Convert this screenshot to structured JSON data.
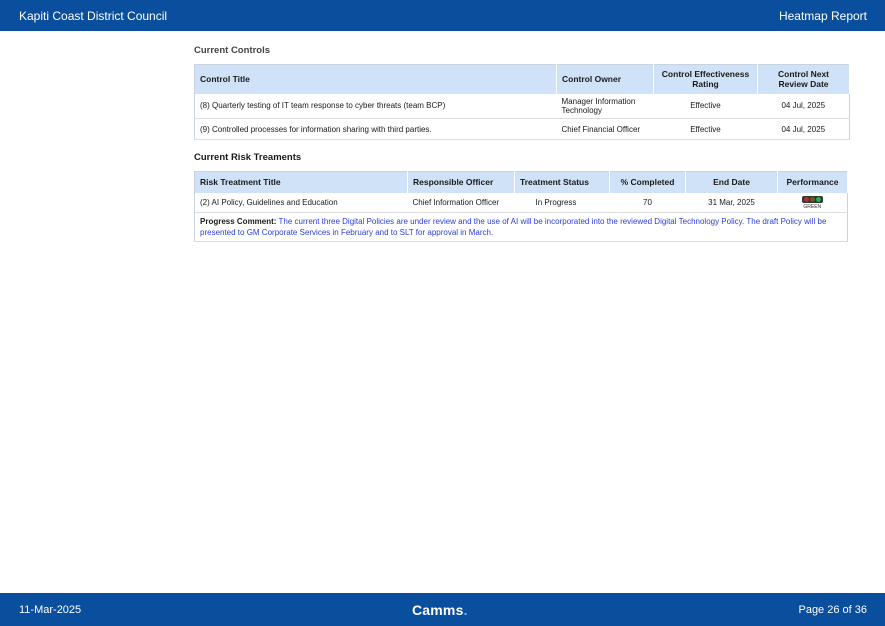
{
  "header": {
    "org": "Kapiti Coast District Council",
    "report": "Heatmap Report"
  },
  "controls": {
    "section_title": "Current Controls",
    "columns": [
      "Control Title",
      "Control Owner",
      "Control Effectiveness Rating",
      "Control Next Review Date"
    ],
    "rows": [
      {
        "title": "(8) Quarterly testing of IT team response to cyber threats (team BCP)",
        "owner": "Manager Information Technology",
        "rating": "Effective",
        "review_date": "04 Jul, 2025"
      },
      {
        "title": "(9) Controlled processes for information sharing with third parties.",
        "owner": "Chief Financial Officer",
        "rating": "Effective",
        "review_date": "04 Jul, 2025"
      }
    ]
  },
  "treatments": {
    "section_title": "Current Risk Treaments",
    "columns": [
      "Risk Treatment Title",
      "Responsible Officer",
      "Treatment Status",
      "% Completed",
      "End Date",
      "Performance"
    ],
    "rows": [
      {
        "title": "(2) AI Policy, Guidelines and Education",
        "officer": "Chief Information Officer",
        "status": "In Progress",
        "completed": "70",
        "end_date": "31 Mar, 2025",
        "performance": "GREEN"
      }
    ],
    "progress_label": "Progress Comment:",
    "progress_comment": "The current three Digital Policies are under review and the use of AI will be incorporated into the reviewed Digital Technology Policy. The draft Policy will be presented to GM Corporate Services in February and to SLT for approval in March."
  },
  "footer": {
    "date": "11-Mar-2025",
    "brand": "Camms",
    "brand_suffix": ".",
    "page": "Page 26 of 36"
  },
  "colors": {
    "bar": "#0a4f9e",
    "header_fill": "#cfe2f7",
    "comment_text": "#2b3fd6",
    "light_red": "#b03030",
    "light_amber": "#6a5a2a",
    "light_green": "#22b14c"
  }
}
